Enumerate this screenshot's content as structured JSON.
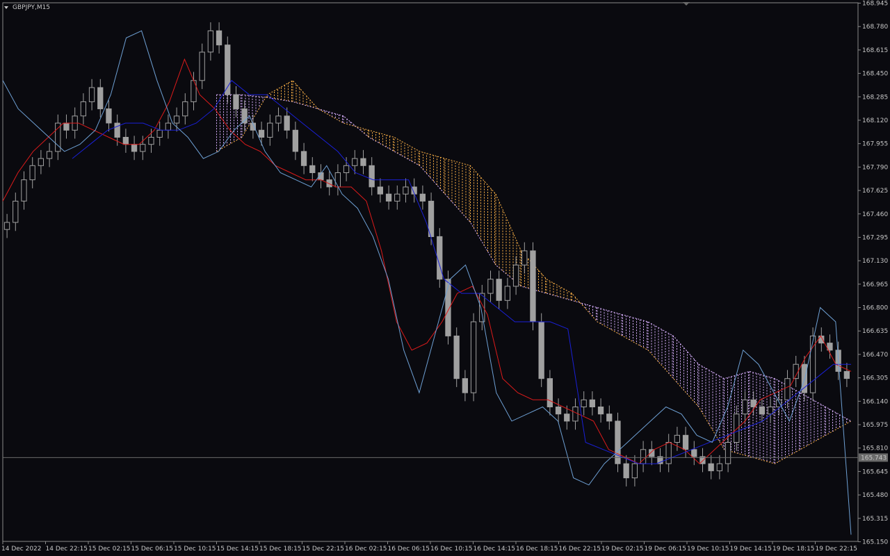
{
  "window": {
    "symbol_label": "GBPJPY,M15",
    "background": "#0a0a0f",
    "frame_color": "#8a8a8a",
    "text_color": "#c8c8c8"
  },
  "chart_data": {
    "type": "line",
    "title": "GBPJPY,M15",
    "xlabel": "",
    "ylabel": "",
    "ylim": [
      165.15,
      168.945
    ],
    "grid": false,
    "current_price": 165.743,
    "current_price_label": "165.743",
    "y_ticks": [
      "168.945",
      "168.780",
      "168.615",
      "168.450",
      "168.285",
      "168.120",
      "167.955",
      "167.790",
      "167.625",
      "167.460",
      "167.295",
      "167.130",
      "166.965",
      "166.800",
      "166.635",
      "166.470",
      "166.305",
      "166.140",
      "165.975",
      "165.810",
      "165.645",
      "165.480",
      "165.315",
      "165.150"
    ],
    "x_ticks": [
      "14 Dec 2022",
      "14 Dec 22:15",
      "15 Dec 02:15",
      "15 Dec 06:15",
      "15 Dec 10:15",
      "15 Dec 14:15",
      "15 Dec 18:15",
      "15 Dec 22:15",
      "16 Dec 02:15",
      "16 Dec 06:15",
      "16 Dec 10:15",
      "16 Dec 14:15",
      "16 Dec 18:15",
      "16 Dec 22:15",
      "19 Dec 02:15",
      "19 Dec 06:15",
      "19 Dec 10:15",
      "19 Dec 14:15",
      "19 Dec 18:15",
      "19 Dec 22:15"
    ],
    "candle_color": "#a0a0a0",
    "closes": [
      167.4,
      167.55,
      167.7,
      167.8,
      167.85,
      167.9,
      168.1,
      168.05,
      168.15,
      168.25,
      168.35,
      168.2,
      168.1,
      168.0,
      167.95,
      167.9,
      167.95,
      168.0,
      168.05,
      168.1,
      168.15,
      168.25,
      168.4,
      168.6,
      168.75,
      168.65,
      168.3,
      168.2,
      168.1,
      168.05,
      168.0,
      168.1,
      168.15,
      168.05,
      167.9,
      167.8,
      167.75,
      167.7,
      167.65,
      167.75,
      167.8,
      167.85,
      167.8,
      167.65,
      167.6,
      167.55,
      167.6,
      167.65,
      167.6,
      167.55,
      167.3,
      167.0,
      166.6,
      166.3,
      166.2,
      166.7,
      166.9,
      167.0,
      166.85,
      166.95,
      167.1,
      167.2,
      166.7,
      166.3,
      166.1,
      166.05,
      166.0,
      166.1,
      166.15,
      166.1,
      166.05,
      166.0,
      165.7,
      165.6,
      165.7,
      165.8,
      165.75,
      165.7,
      165.85,
      165.9,
      165.8,
      165.75,
      165.7,
      165.65,
      165.7,
      165.85,
      166.05,
      166.15,
      166.1,
      166.05,
      166.1,
      166.15,
      166.3,
      166.4,
      166.2,
      166.6,
      166.55,
      166.5,
      166.35,
      166.3
    ],
    "series": [
      {
        "name": "",
        "color": "#dd1b1b",
        "values": [
          167.55,
          167.75,
          167.9,
          168.0,
          168.1,
          168.1,
          168.05,
          168.0,
          167.95,
          167.95,
          168.05,
          168.25,
          168.55,
          168.3,
          168.2,
          168.05,
          167.95,
          167.9,
          167.8,
          167.75,
          167.7,
          167.7,
          167.65,
          167.65,
          167.55,
          167.2,
          166.7,
          166.5,
          166.55,
          166.7,
          166.9,
          166.95,
          166.75,
          166.3,
          166.2,
          166.15,
          166.15,
          166.1,
          166.05,
          166.0,
          165.8,
          165.75,
          165.7,
          165.8,
          165.85,
          165.8,
          165.7,
          165.8,
          165.9,
          166.0,
          166.15,
          166.2,
          166.25,
          166.45,
          166.6,
          166.4,
          166.35
        ]
      },
      {
        "name": "",
        "color": "#1a20d8",
        "values": [
          167.85,
          167.95,
          168.05,
          168.1,
          168.1,
          168.05,
          168.05,
          168.1,
          168.2,
          168.4,
          168.3,
          168.3,
          168.2,
          168.1,
          168.0,
          167.9,
          167.75,
          167.7,
          167.7,
          167.7,
          167.4,
          167.0,
          166.9,
          166.9,
          166.8,
          166.7,
          166.7,
          166.7,
          166.65,
          165.85,
          165.8,
          165.75,
          165.7,
          165.7,
          165.75,
          165.8,
          165.85,
          165.9,
          165.95,
          166.0,
          166.1,
          166.2,
          166.3,
          166.4,
          166.4
        ]
      },
      {
        "name": "",
        "color": "#6ea0d4",
        "values": [
          168.4,
          168.2,
          168.1,
          168.0,
          167.9,
          167.95,
          168.05,
          168.3,
          168.7,
          168.75,
          168.4,
          168.1,
          168.0,
          167.85,
          167.9,
          168.05,
          168.15,
          167.9,
          167.75,
          167.7,
          167.65,
          167.8,
          167.6,
          167.5,
          167.3,
          167.0,
          166.5,
          166.2,
          166.6,
          167.0,
          167.1,
          166.8,
          166.2,
          166.0,
          166.05,
          166.1,
          166.0,
          165.6,
          165.55,
          165.7,
          165.8,
          165.9,
          166.0,
          166.1,
          166.05,
          165.9,
          165.85,
          166.1,
          166.5,
          166.4,
          166.2,
          166.0,
          166.3,
          166.8,
          166.7,
          165.2
        ]
      },
      {
        "name": "",
        "color": "#d9b0ff",
        "values": [
          168.3,
          168.3,
          168.28,
          168.25,
          168.2,
          168.15,
          168.0,
          167.9,
          167.8,
          167.6,
          167.4,
          167.1,
          166.95,
          166.9,
          166.85,
          166.8,
          166.75,
          166.7,
          166.6,
          166.4,
          166.3,
          166.35,
          166.3,
          166.2,
          166.1,
          166.0
        ]
      },
      {
        "name": "",
        "color": "#ffb347",
        "values": [
          167.9,
          168.0,
          168.3,
          168.4,
          168.2,
          168.1,
          168.05,
          168.0,
          167.9,
          167.85,
          167.8,
          167.6,
          167.2,
          167.0,
          166.9,
          166.7,
          166.6,
          166.5,
          166.3,
          166.1,
          165.8,
          165.75,
          165.7,
          165.8,
          165.9,
          166.0
        ]
      }
    ]
  }
}
